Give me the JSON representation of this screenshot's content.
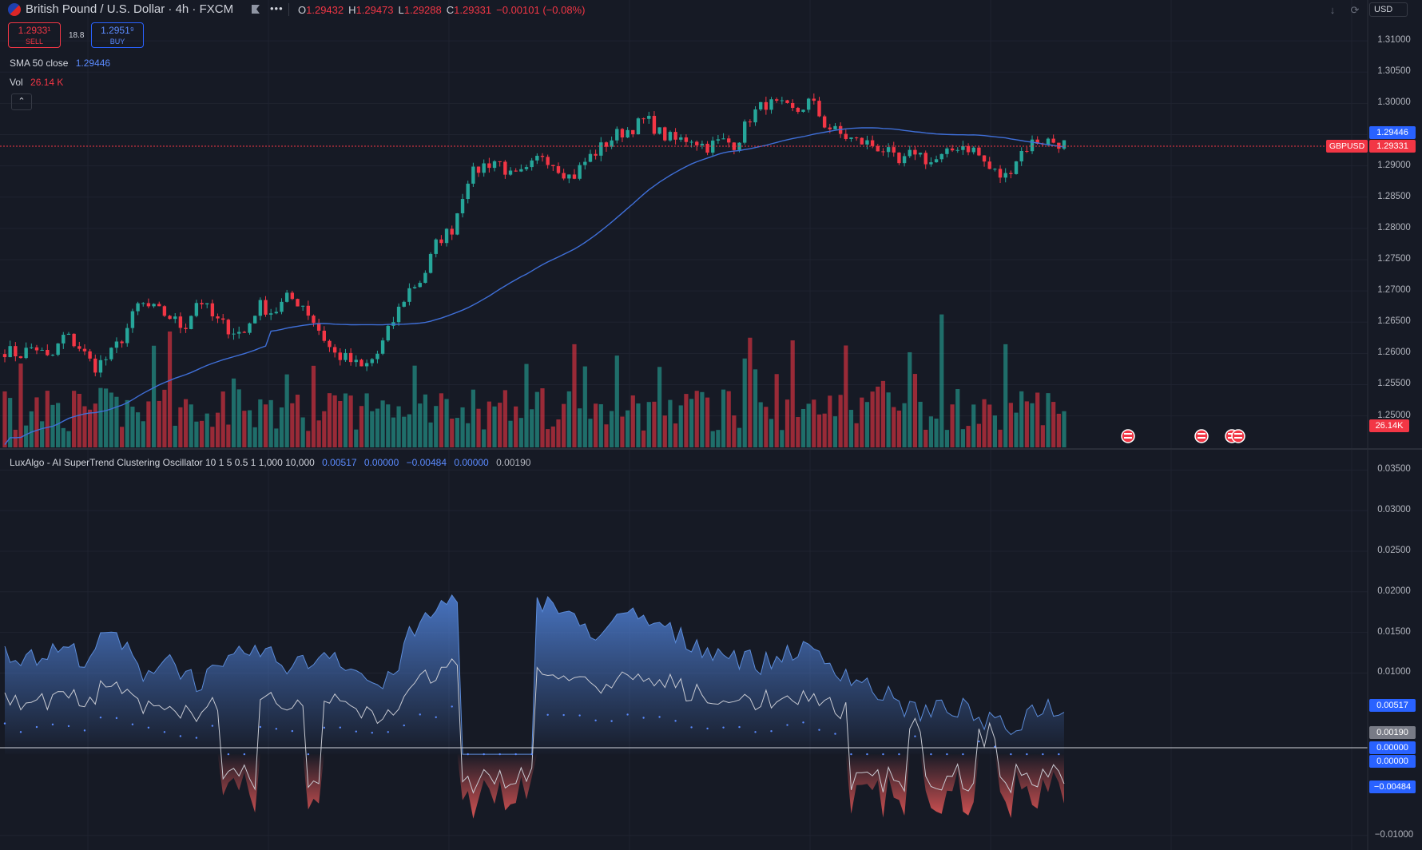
{
  "header": {
    "symbol_title": "British Pound / U.S. Dollar · 4h · FXCM",
    "more_icon": "more-icon",
    "ohlc": [
      {
        "k": "O",
        "v": "1.29432"
      },
      {
        "k": "H",
        "v": "1.29473"
      },
      {
        "k": "L",
        "v": "1.29288"
      },
      {
        "k": "C",
        "v": "1.29331"
      },
      {
        "k": "",
        "v": "−0.00101 (−0.08%)"
      }
    ],
    "currency": "USD"
  },
  "trade": {
    "sell_price": "1.2933¹",
    "sell_label": "SELL",
    "spread": "18.8",
    "buy_price": "1.2951⁹",
    "buy_label": "BUY"
  },
  "indicators": {
    "sma_name": "SMA 50 close",
    "sma_value": "1.29446",
    "vol_name": "Vol",
    "vol_value": "26.14 K"
  },
  "oscillator_legend": {
    "name": "LuxAlgo - AI SuperTrend Clustering Oscillator 10 1 5 0.5 1 1,000 10,000",
    "values": [
      "0.00517",
      "0.00000",
      "−0.00484",
      "0.00000",
      "0.00190"
    ]
  },
  "price_axis_ticks": [
    "1.31000",
    "1.30500",
    "1.30000",
    "1.29500",
    "1.29000",
    "1.28500",
    "1.28000",
    "1.27500",
    "1.27000",
    "1.26500",
    "1.26000",
    "1.25500",
    "1.25000"
  ],
  "osc_axis_ticks": [
    "0.03500",
    "0.03000",
    "0.02500",
    "0.02000",
    "0.01500",
    "0.01000",
    "−0.01000"
  ],
  "price_tags": {
    "sma": "1.29446",
    "symbol": "GBPUSD",
    "last": "1.29331",
    "volume": "26.14K"
  },
  "osc_tags": [
    "0.00517",
    "0.00190",
    "0.00000",
    "0.00000",
    "−0.00484"
  ],
  "colors": {
    "bg": "#161a25",
    "up": "#26a69a",
    "down": "#f23645",
    "sma": "#3f6fd8",
    "osc_bull": "#4a78c8",
    "osc_bear": "#e05656"
  },
  "chart_data": [
    {
      "type": "candlestick",
      "title": "British Pound / U.S. Dollar · 4h · FXCM",
      "ylim": [
        1.2465,
        1.3127
      ],
      "ohlc_anchors": [
        1.2605,
        1.2598,
        1.2612,
        1.2588,
        1.263,
        1.261,
        1.2578,
        1.2595,
        1.263,
        1.268,
        1.267,
        1.266,
        1.264,
        1.269,
        1.2655,
        1.264,
        1.263,
        1.2678,
        1.2665,
        1.269,
        1.2678,
        1.264,
        1.26,
        1.259,
        1.2575,
        1.26,
        1.265,
        1.27,
        1.272,
        1.278,
        1.28,
        1.288,
        1.29,
        1.291,
        1.288,
        1.289,
        1.292,
        1.29,
        1.288,
        1.291,
        1.293,
        1.295,
        1.296,
        1.2975,
        1.295,
        1.294,
        1.2945,
        1.293,
        1.294,
        1.2935,
        1.298,
        1.3,
        1.2995,
        1.2985,
        1.3005,
        1.2965,
        1.295,
        1.294,
        1.2935,
        1.2925,
        1.29,
        1.2925,
        1.2905,
        1.2915,
        1.2935,
        1.2925,
        1.2895,
        1.288,
        1.292,
        1.294,
        1.294,
        1.2935
      ],
      "candle_count": 200,
      "volume_last": "26.14K",
      "sma": {
        "name": "SMA 50 close",
        "last": 1.29446
      }
    },
    {
      "type": "area",
      "title": "LuxAlgo - AI SuperTrend Clustering Oscillator 10 1 5 0.5 1 1,000 10,000",
      "ylim": [
        -0.0118,
        0.0372
      ],
      "series": [
        {
          "name": "upper",
          "anchors": [
            0.013,
            0.0115,
            0.013,
            0.012,
            0.015,
            0.01,
            0.012,
            0.009,
            0.01,
            0.013,
            0.0115,
            0.011,
            0.013,
            0.01,
            0.008,
            0.015,
            0.018,
            0.021,
            0.019,
            0.017,
            0.019,
            0.016,
            0.015,
            0.017,
            0.016,
            0.014,
            0.013,
            0.012,
            0.011,
            0.013,
            0.012,
            0.01,
            0.008,
            0.006,
            0.005,
            0.006,
            0.004,
            0.003,
            0.006,
            0.0055
          ]
        },
        {
          "name": "oscillator",
          "last": 0.0019
        },
        {
          "name": "lower",
          "last": -0.00484
        }
      ],
      "markers": [
        "0.00517",
        "0.00000",
        "−0.00484",
        "0.00000",
        "0.00190"
      ]
    }
  ]
}
